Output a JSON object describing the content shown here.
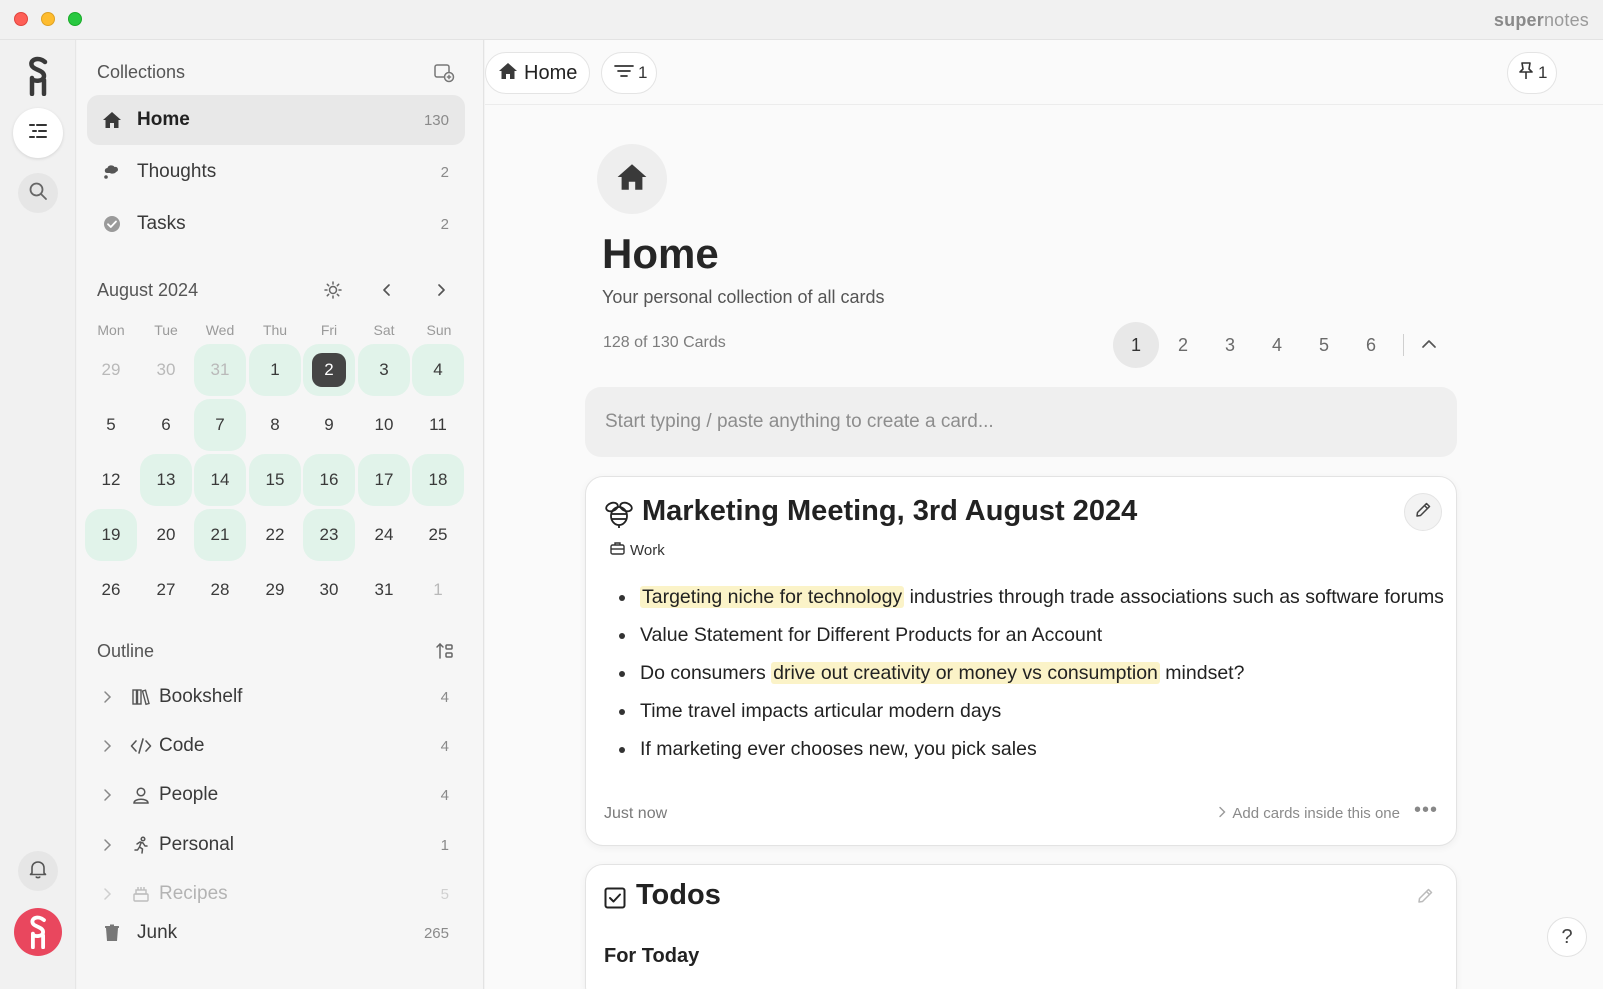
{
  "app": {
    "brand_light": "super",
    "brand_rest": "notes",
    "accent_color": "#e9475e",
    "calendar_highlight": "#e1f3ea"
  },
  "rail": {
    "logo_icon": "supernotes-logo-icon",
    "items": [
      "cards-list-icon",
      "search-icon",
      "bell-icon"
    ],
    "avatar_glyph": "S"
  },
  "sidebar": {
    "collections_title": "Collections",
    "collections": [
      {
        "label": "Home",
        "count": "130",
        "icon": "home-icon"
      },
      {
        "label": "Thoughts",
        "count": "2",
        "icon": "thought-bubble-icon"
      },
      {
        "label": "Tasks",
        "count": "2",
        "icon": "check-circle-icon"
      }
    ],
    "calendar": {
      "title": "August 2024",
      "weekdays": [
        "Mon",
        "Tue",
        "Wed",
        "Thu",
        "Fri",
        "Sat",
        "Sun"
      ],
      "weeks": [
        [
          "29",
          "30",
          "31",
          "1",
          "2",
          "3",
          "4"
        ],
        [
          "5",
          "6",
          "7",
          "8",
          "9",
          "10",
          "11"
        ],
        [
          "12",
          "13",
          "14",
          "15",
          "16",
          "17",
          "18"
        ],
        [
          "19",
          "20",
          "21",
          "22",
          "23",
          "24",
          "25"
        ],
        [
          "26",
          "27",
          "28",
          "29",
          "30",
          "31",
          "1"
        ]
      ],
      "selected": "2"
    },
    "outline_title": "Outline",
    "outline": [
      {
        "label": "Bookshelf",
        "count": "4",
        "icon": "books-icon"
      },
      {
        "label": "Code",
        "count": "4",
        "icon": "code-icon"
      },
      {
        "label": "People",
        "count": "4",
        "icon": "person-icon"
      },
      {
        "label": "Personal",
        "count": "1",
        "icon": "running-person-icon"
      },
      {
        "label": "Recipes",
        "count": "5",
        "icon": "cake-icon"
      }
    ],
    "junk": {
      "label": "Junk",
      "count": "265"
    }
  },
  "toolbar": {
    "home_label": "Home",
    "filter_count": "1",
    "pin_count": "1"
  },
  "main": {
    "title": "Home",
    "subtitle": "Your personal collection of all cards",
    "card_count": "128 of 130 Cards",
    "pages": [
      "1",
      "2",
      "3",
      "4",
      "5",
      "6"
    ],
    "active_page": "1",
    "composer_placeholder": "Start typing / paste anything to create a card..."
  },
  "cards": [
    {
      "title": "Marketing Meeting, 3rd August 2024",
      "icon": "bee-icon",
      "tag": "Work",
      "bullets": [
        {
          "highlight": "Targeting niche for technology",
          "rest": " industries through trade associations such as software forums"
        },
        {
          "text": "Value Statement for Different Products for an Account"
        },
        {
          "pre": "Do consumers ",
          "highlight": "drive out creativity or money vs consumption",
          "post": " mindset?"
        },
        {
          "text": "Time travel impacts articular modern days"
        },
        {
          "text": "If marketing ever chooses new, you pick sales"
        }
      ],
      "timestamp": "Just now",
      "add_inside": "Add cards inside this one",
      "more": "•••"
    },
    {
      "title": "Todos",
      "icon": "checkbox-icon",
      "subheading": "For Today"
    }
  ],
  "help_label": "?"
}
